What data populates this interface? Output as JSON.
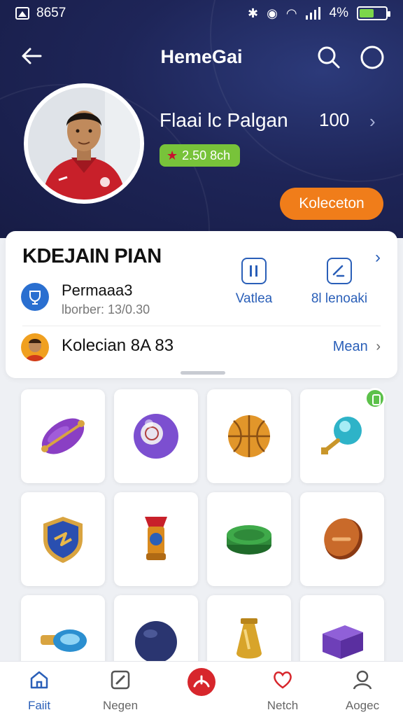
{
  "status_bar": {
    "time": "8657",
    "battery_text": "4%"
  },
  "header": {
    "title": "HemeGai",
    "back_icon": "arrow-left-icon",
    "search_icon": "search-icon",
    "circle_icon": "circle-icon"
  },
  "profile": {
    "name": "Flaai lc Palgan",
    "count": "100",
    "badge": "2.50 8ch",
    "collection_button": "Koleceton"
  },
  "card": {
    "title": "KDEJAIN PIAN",
    "actions": [
      {
        "label": "Vatlea",
        "icon": "pause-icon"
      },
      {
        "label": "8l lenoaki",
        "icon": "chart-icon"
      }
    ],
    "permission": {
      "title": "Permaaa3",
      "subtitle": "lborber: 13/0.30"
    },
    "collection": {
      "label": "Kolecian 8A 83",
      "link": "Mean"
    }
  },
  "items": [
    {
      "name": "purple-rugby-ball-icon",
      "color": "#8a3fc4"
    },
    {
      "name": "purple-ball-icon",
      "color": "#7c4fd0"
    },
    {
      "name": "orange-basketball-icon",
      "color": "#e2962a"
    },
    {
      "name": "teal-orb-key-icon",
      "color": "#2eb3c8",
      "badge": true
    },
    {
      "name": "blue-shield-icon",
      "color": "#2a4fb0"
    },
    {
      "name": "gold-medal-icon",
      "color": "#d98a1e"
    },
    {
      "name": "green-puck-icon",
      "color": "#2f8a3a"
    },
    {
      "name": "copper-coin-icon",
      "color": "#c96a2a"
    },
    {
      "name": "blue-key-icon",
      "color": "#2b8fd0"
    },
    {
      "name": "navy-ball-icon",
      "color": "#2a3570"
    },
    {
      "name": "gold-vase-icon",
      "color": "#d8a42a"
    },
    {
      "name": "purple-box-icon",
      "color": "#6e3fb8"
    }
  ],
  "bottom_nav": [
    {
      "label": "Faiit",
      "icon": "home-icon",
      "active": true
    },
    {
      "label": "Negen",
      "icon": "edit-icon",
      "active": false
    },
    {
      "label": "",
      "icon": "center-action-icon",
      "active": false
    },
    {
      "label": "Netch",
      "icon": "heart-icon",
      "active": false
    },
    {
      "label": "Aogec",
      "icon": "user-icon",
      "active": false
    }
  ]
}
